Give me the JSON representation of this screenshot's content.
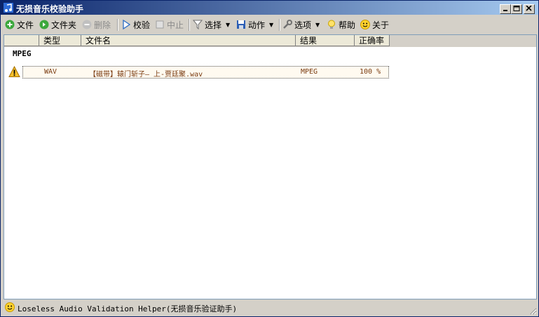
{
  "window": {
    "title": "无损音乐校验助手"
  },
  "toolbar": {
    "file": "文件",
    "folder": "文件夹",
    "delete": "删除",
    "verify": "校验",
    "stop": "中止",
    "select": "选择",
    "action": "动作",
    "options": "选项",
    "help": "帮助",
    "about": "关于"
  },
  "list": {
    "columns": [
      "类型",
      "文件名",
      "结果",
      "正确率"
    ],
    "group": "MPEG",
    "rows": [
      {
        "type": "WAV",
        "filename": "【磁带】辕门斩子— 上-贾廷聚.wav",
        "result": "MPEG",
        "accuracy": "100 %"
      }
    ]
  },
  "status": {
    "text": "Loseless Audio Validation Helper(无损音乐验证助手)"
  },
  "colors": {
    "titlebar_start": "#0a246a",
    "titlebar_end": "#a6caf0",
    "row_text": "#7a3b10"
  }
}
